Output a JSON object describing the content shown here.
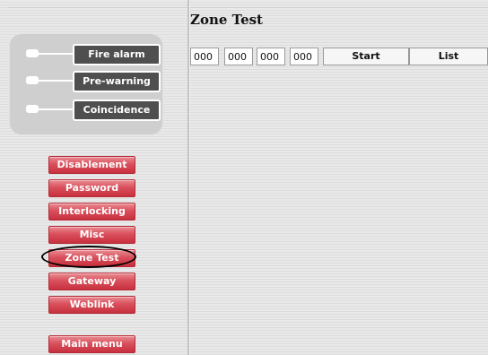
{
  "page_title": "Zone Test",
  "status_indicators": [
    {
      "label": "Fire alarm",
      "led": "off"
    },
    {
      "label": "Pre-warning",
      "led": "off"
    },
    {
      "label": "Coincidence",
      "led": "off"
    }
  ],
  "menu": {
    "items": [
      "Disablement",
      "Password",
      "Interlocking",
      "Misc",
      "Zone Test",
      "Gateway",
      "Weblink"
    ],
    "main_menu": "Main menu",
    "selected": "Zone Test"
  },
  "toolbar": {
    "inputs": [
      "000",
      "000",
      "000",
      "000"
    ],
    "start_label": "Start",
    "list_label": "List"
  },
  "colors": {
    "menu_button": "#d0404c",
    "status_label_bg": "#4f4f4f",
    "panel_bg": "#cfcfcf"
  }
}
